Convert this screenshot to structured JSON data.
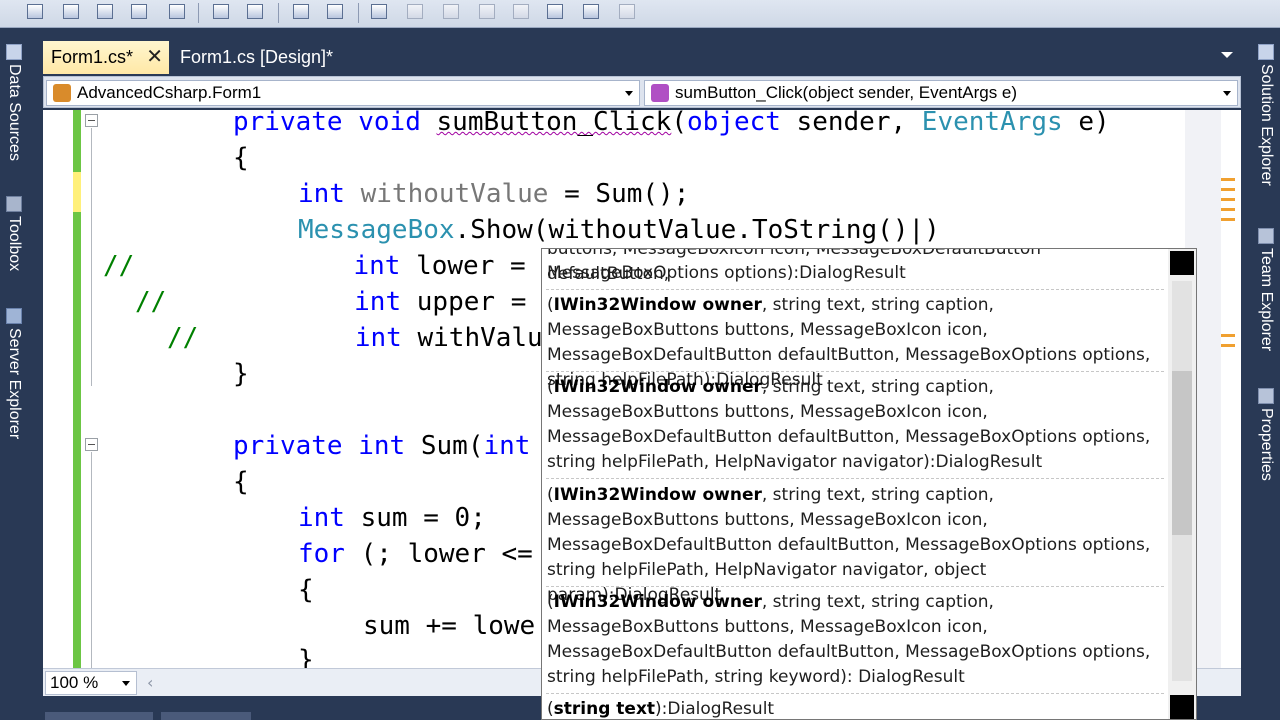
{
  "colors": {
    "chrome": "#293955",
    "active_tab": "#ffe8a6",
    "keyword": "#0000ff",
    "type": "#2b91af",
    "comment": "#008000",
    "change_bar": "#6cc644"
  },
  "left_dock": {
    "items": [
      {
        "label": "Data Sources",
        "icon": "data-sources-icon"
      },
      {
        "label": "Toolbox",
        "icon": "toolbox-icon"
      },
      {
        "label": "Server Explorer",
        "icon": "server-explorer-icon"
      }
    ]
  },
  "right_dock": {
    "items": [
      {
        "label": "Solution Explorer",
        "icon": "solution-explorer-icon"
      },
      {
        "label": "Team Explorer",
        "icon": "team-explorer-icon"
      },
      {
        "label": "Properties",
        "icon": "properties-icon"
      }
    ]
  },
  "tabs": [
    {
      "label": "Form1.cs*",
      "active": true
    },
    {
      "label": "Form1.cs [Design]*",
      "active": false
    }
  ],
  "nav": {
    "class_combo": "AdvancedCsharp.Form1",
    "member_combo": "sumButton_Click(object sender, EventArgs e)"
  },
  "code": {
    "line1": {
      "kw1": "private",
      "kw2": "void",
      "name": "sumButton_Click",
      "open": "(",
      "kw3": "object",
      "param1": " sender, ",
      "type": "EventArgs",
      "rest": " e)"
    },
    "line2": "{",
    "line3": {
      "kw": "int",
      "var": "withoutValue",
      "rest": " = Sum();"
    },
    "line4": {
      "type": "MessageBox",
      "rest": ".Show(withoutValue.ToString()",
      "caret": "|",
      "close": ")"
    },
    "line5": {
      "comment": "//",
      "kw": "int",
      "rest": " lower = C"
    },
    "line6": {
      "comment": "//",
      "kw": "int",
      "rest": " upper = C"
    },
    "line7": {
      "comment": "//",
      "kw": "int",
      "rest": " withValue"
    },
    "line8": "}",
    "line9": {
      "kw1": "private",
      "kw2": "int",
      "name": "Sum",
      "rest": "(",
      "kw3": "int"
    },
    "line10": "{",
    "line11": {
      "kw": "int",
      "rest": " sum = 0;"
    },
    "line12": {
      "kw": "for",
      "rest": " (; lower <="
    },
    "line13": "{",
    "line14": "sum += lowe",
    "line15": "}"
  },
  "zoom": "100 %",
  "param_info": {
    "partial_top": "buttons, MessageBoxIcon icon, MessageBoxDefaultButton defaultButton,",
    "overloads": [
      {
        "bold": "",
        "text": "MessageBoxOptions options):DialogResult"
      },
      {
        "bold": "IWin32Window owner",
        "text": ", string text, string caption, MessageBoxButtons buttons, MessageBoxIcon icon, MessageBoxDefaultButton defaultButton, MessageBoxOptions options, string helpFilePath):DialogResult"
      },
      {
        "bold": "IWin32Window owner",
        "text": ", string text, string caption, MessageBoxButtons buttons, MessageBoxIcon icon, MessageBoxDefaultButton defaultButton, MessageBoxOptions options, string helpFilePath, HelpNavigator navigator):DialogResult"
      },
      {
        "bold": "IWin32Window owner",
        "text": ", string text, string caption, MessageBoxButtons buttons, MessageBoxIcon icon, MessageBoxDefaultButton defaultButton, MessageBoxOptions options, string helpFilePath, HelpNavigator navigator, object param):DialogResult"
      },
      {
        "bold": "IWin32Window owner",
        "text": ", string text, string caption, MessageBoxButtons buttons, MessageBoxIcon icon, MessageBoxDefaultButton defaultButton, MessageBoxOptions options, string helpFilePath, string keyword): DialogResult"
      },
      {
        "bold": "string text",
        "text": "):DialogResult"
      }
    ]
  }
}
